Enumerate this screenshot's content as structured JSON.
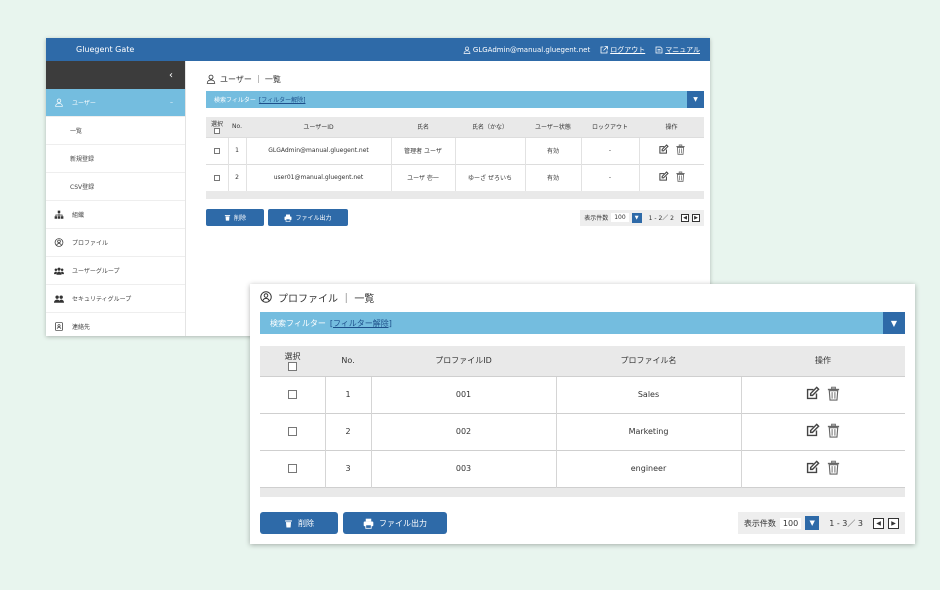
{
  "back": {
    "header": {
      "brand": "Gluegent Gate",
      "account": "GLGAdmin@manual.gluegent.net",
      "logout": "ログアウト",
      "manual": "マニュアル"
    },
    "sidebar": {
      "collapse_icon": "‹",
      "users_label": "ユーザー",
      "users_chevron": "–",
      "sub_list": "一覧",
      "sub_new": "新規登録",
      "sub_csv": "CSV登録",
      "org": "組織",
      "profile": "プロファイル",
      "user_group": "ユーザーグループ",
      "security_group": "セキュリティグループ",
      "contact": "連絡先"
    },
    "title": "ユーザー ｜ 一覧",
    "filter": {
      "label": "検索フィルター",
      "link": "[フィルター解除]"
    },
    "table": {
      "headers": [
        "選択",
        "No.",
        "ユーザーID",
        "氏名",
        "氏名（かな）",
        "ユーザー状態",
        "ロックアウト",
        "操作"
      ],
      "rows": [
        {
          "no": "1",
          "id": "GLGAdmin@manual.gluegent.net",
          "name": "管理者 ユーザ",
          "kana": "",
          "status": "有効",
          "lockout": "-"
        },
        {
          "no": "2",
          "id": "user01@manual.gluegent.net",
          "name": "ユーザ 壱一",
          "kana": "ゆーざ ぜろいち",
          "status": "有効",
          "lockout": "-"
        }
      ]
    },
    "actions": {
      "delete": "削除",
      "export": "ファイル出力"
    },
    "pager": {
      "label": "表示件数",
      "size": "100",
      "range": "1 - 2／ 2"
    }
  },
  "front": {
    "title": "プロファイル ｜ 一覧",
    "filter": {
      "label": "検索フィルター",
      "link": "[フィルター解除]"
    },
    "table": {
      "headers": [
        "選択",
        "No.",
        "プロファイルID",
        "プロファイル名",
        "操作"
      ],
      "rows": [
        {
          "no": "1",
          "id": "001",
          "name": "Sales"
        },
        {
          "no": "2",
          "id": "002",
          "name": "Marketing"
        },
        {
          "no": "3",
          "id": "003",
          "name": "engineer"
        }
      ]
    },
    "actions": {
      "delete": "削除",
      "export": "ファイル出力"
    },
    "pager": {
      "label": "表示件数",
      "size": "100",
      "range": "1 - 3／ 3"
    }
  },
  "colors": {
    "header": "#2e6aa8",
    "accent": "#74bddf",
    "background": "#e8f5ee"
  },
  "icons": [
    "user-icon",
    "external-link-icon",
    "manual-icon",
    "org-icon",
    "profile-icon",
    "user-group-icon",
    "security-group-icon",
    "contact-icon",
    "edit-icon",
    "trash-icon",
    "printer-icon",
    "chevron-down-icon"
  ]
}
